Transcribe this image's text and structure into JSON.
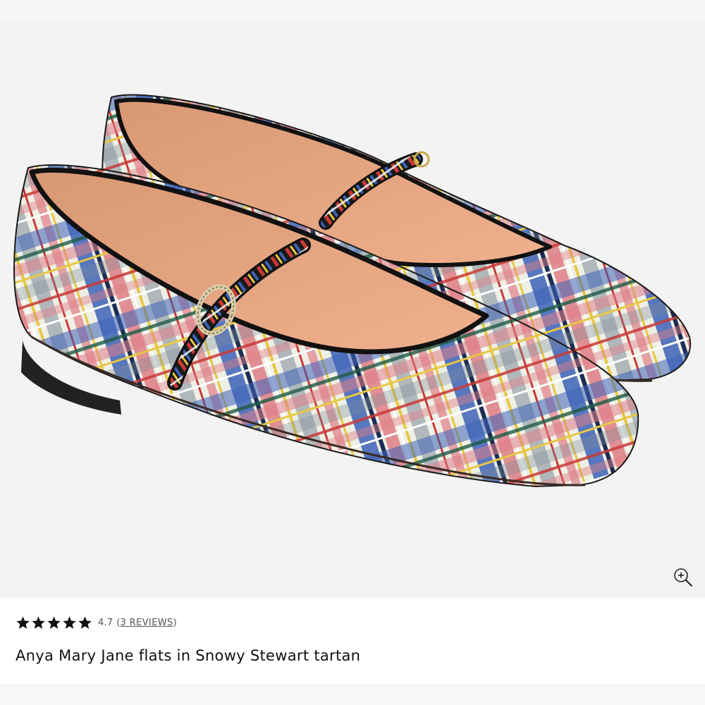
{
  "product": {
    "image_alt": "Anya Mary Jane flats in Snowy Stewart tartan",
    "zoom_icon": "zoom-in-icon",
    "rating": {
      "stars_filled": 5,
      "stars_total": 5,
      "value": "4.7",
      "open_paren": "(",
      "reviews_link": "3 REVIEWS",
      "close_paren": ")"
    },
    "title": "Anya Mary Jane flats in Snowy Stewart tartan"
  },
  "colors": {
    "background": "#f3f3f3",
    "star": "#111111",
    "text": "#111111",
    "muted_text": "#555555"
  }
}
